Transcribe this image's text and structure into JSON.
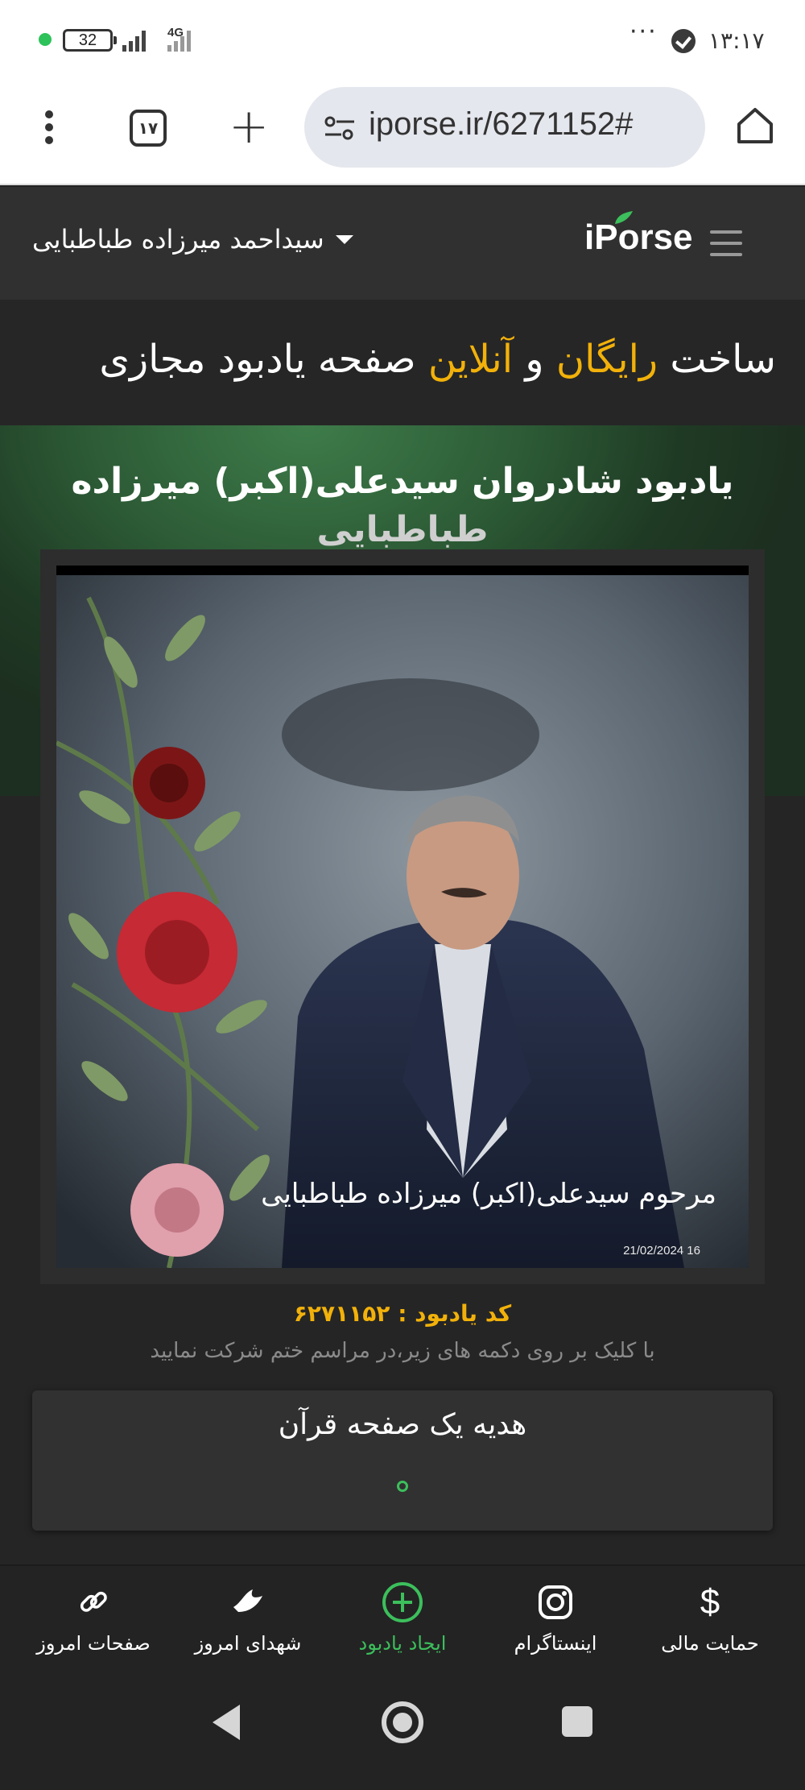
{
  "status_bar": {
    "battery": "32",
    "network": "4G",
    "more": "···",
    "time": "۱۳:۱۷"
  },
  "browser": {
    "tab_count": "۱۷",
    "url": "iporse.ir/6271152#"
  },
  "site_header": {
    "logo": "iPorse",
    "user_name": "سیداحمد میرزاده طباطبایی"
  },
  "promo": {
    "part1": "ساخت ",
    "highlight1": "رایگان",
    "part2": " و ",
    "highlight2": "آنلاین",
    "part3": " صفحه یادبود مجازی",
    "highlight_color": "#f2b10a"
  },
  "memorial": {
    "title_line1": "یادبود شادروان سیدعلی(اکبر) میرزاده",
    "title_line2": "طباطبایی",
    "photo_caption": "مرحوم سیدعلی(اکبر) میرزاده طباطبایی",
    "photo_date": "21/02/2024  16",
    "code_line": "کد یادبود : ۶۲۷۱۱۵۲",
    "hint": "با کلیک بر روی دکمه های زیر،در مراسم ختم شرکت نمایید",
    "quran_title": "هدیه یک صفحه قرآن"
  },
  "bottom_nav": [
    {
      "label": "حمایت مالی",
      "icon": "dollar-icon"
    },
    {
      "label": "اینستاگرام",
      "icon": "instagram-icon"
    },
    {
      "label": "ایجاد یادبود",
      "icon": "add-circle-icon",
      "active": true
    },
    {
      "label": "شهدای امروز",
      "icon": "dove-icon"
    },
    {
      "label": "صفحات امروز",
      "icon": "link-icon"
    }
  ],
  "colors": {
    "accent_green": "#3cbf5c",
    "accent_yellow": "#f2b10a",
    "background": "#232323"
  }
}
